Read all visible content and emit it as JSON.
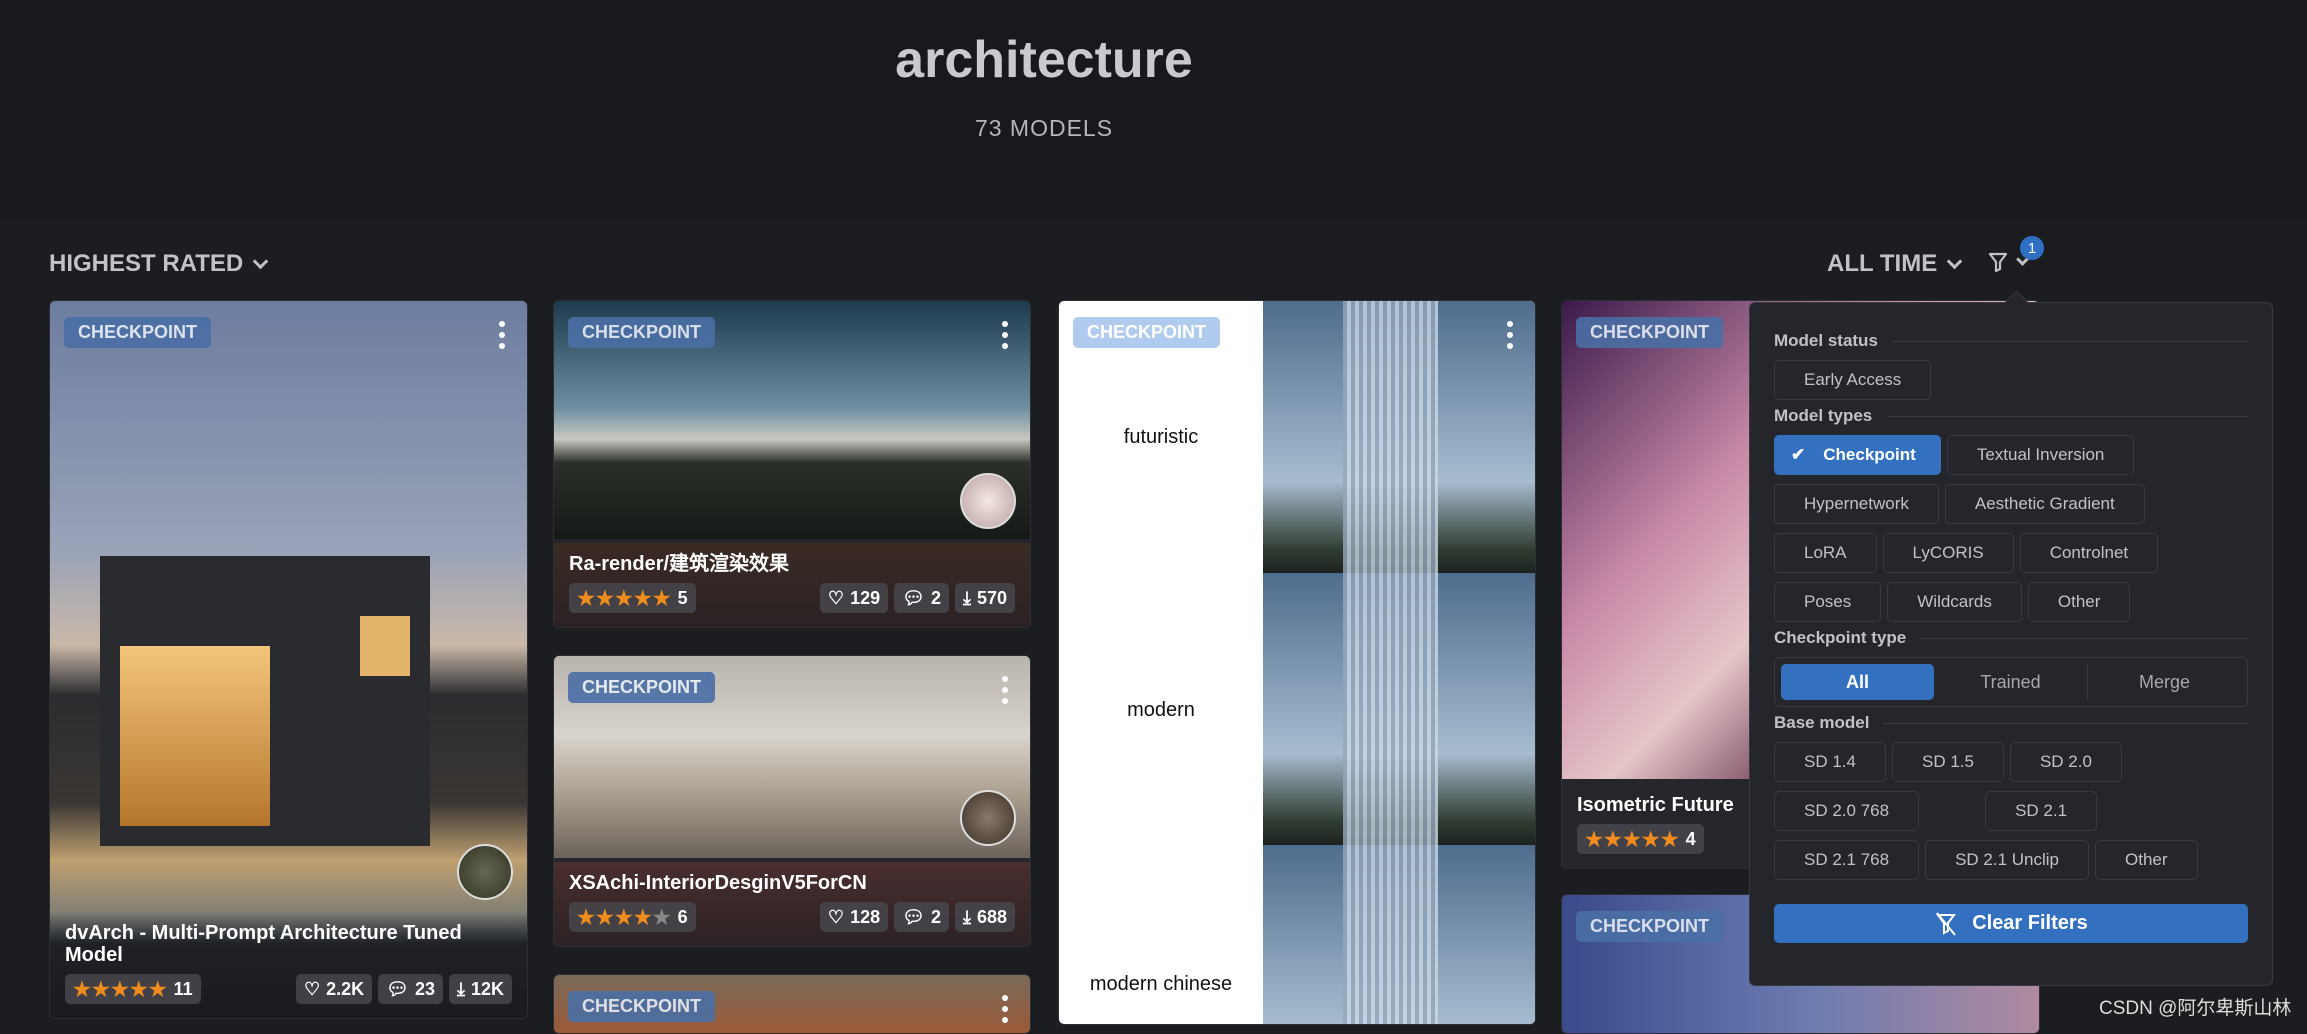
{
  "header": {
    "title": "architecture",
    "count": "73 MODELS"
  },
  "toolbar": {
    "sort": "HIGHEST RATED",
    "period": "ALL TIME",
    "filter_badge": "1"
  },
  "cards": [
    {
      "badge": "CHECKPOINT",
      "title": "dvArch - Multi-Prompt Architecture Tuned Model",
      "rating": 5,
      "reviews": "11",
      "likes": "2.2K",
      "comments": "23",
      "downloads": "12K"
    },
    {
      "badge": "CHECKPOINT",
      "title": "Ra-render/建筑渲染效果",
      "rating": 5,
      "reviews": "5",
      "likes": "129",
      "comments": "2",
      "downloads": "570"
    },
    {
      "badge": "CHECKPOINT",
      "title": "XSAchi-InteriorDesginV5ForCN",
      "rating": 4.5,
      "reviews": "6",
      "likes": "128",
      "comments": "2",
      "downloads": "688"
    },
    {
      "badge": "CHECKPOINT"
    },
    {
      "badge": "CHECKPOINT",
      "labels": [
        "futuristic",
        "modern",
        "modern chinese"
      ]
    },
    {
      "badge": "CHECKPOINT",
      "title": "Isometric Future",
      "rating": 5,
      "reviews": "4"
    },
    {
      "badge": "CHECKPOINT"
    }
  ],
  "filters": {
    "model_status": {
      "label": "Model status",
      "options": [
        "Early Access"
      ]
    },
    "model_types": {
      "label": "Model types",
      "options": [
        "Checkpoint",
        "Textual Inversion",
        "Hypernetwork",
        "Aesthetic Gradient",
        "LoRA",
        "LyCORIS",
        "Controlnet",
        "Poses",
        "Wildcards",
        "Other"
      ],
      "selected": "Checkpoint"
    },
    "checkpoint_type": {
      "label": "Checkpoint type",
      "options": [
        "All",
        "Trained",
        "Merge"
      ],
      "selected": "All"
    },
    "base_model": {
      "label": "Base model",
      "options": [
        "SD 1.4",
        "SD 1.5",
        "SD 2.0",
        "SD 2.0 768",
        "SD 2.1",
        "SD 2.1 768",
        "SD 2.1 Unclip",
        "Other"
      ]
    },
    "clear_label": "Clear Filters"
  },
  "colors": {
    "accent": "#3470c0",
    "star": "#f08c1e",
    "badge": "#4a6fa5"
  },
  "watermark": "CSDN @阿尔卑斯山林"
}
